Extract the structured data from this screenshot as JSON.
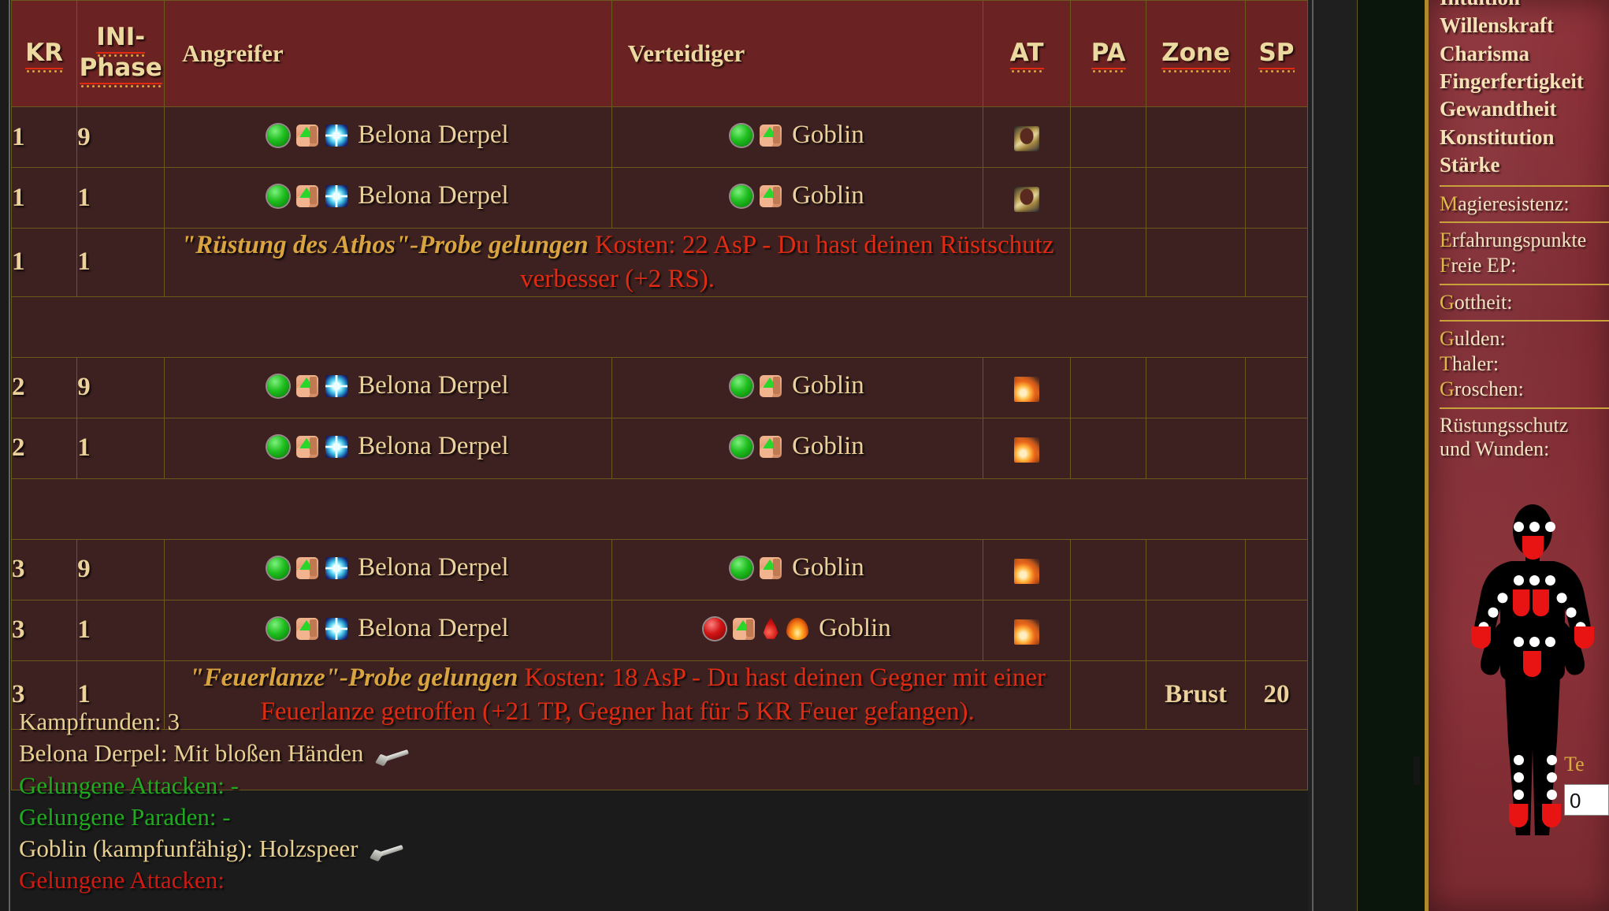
{
  "table": {
    "headers": {
      "kr": "KR",
      "ini_line1": "INI-",
      "ini_line2": "Phase",
      "angreifer": "Angreifer",
      "verteidiger": "Verteidiger",
      "at": "AT",
      "pa": "PA",
      "zone": "Zone",
      "sp": "SP"
    },
    "rows": [
      {
        "type": "combat",
        "kr": "1",
        "ini": "9",
        "attacker": "Belona Derpel",
        "attacker_icons": [
          "green-ball",
          "flex-arm",
          "sparkle"
        ],
        "defender": "Goblin",
        "defender_icons": [
          "green-ball",
          "flex-arm"
        ],
        "at_icon": "spell-armor",
        "pa": "",
        "zone": "",
        "sp": ""
      },
      {
        "type": "combat",
        "kr": "1",
        "ini": "1",
        "attacker": "Belona Derpel",
        "attacker_icons": [
          "green-ball",
          "flex-arm",
          "sparkle"
        ],
        "defender": "Goblin",
        "defender_icons": [
          "green-ball",
          "flex-arm"
        ],
        "at_icon": "spell-armor",
        "pa": "",
        "zone": "",
        "sp": ""
      },
      {
        "type": "message",
        "kr": "1",
        "ini": "1",
        "spell": "\"Rüstung des Athos\"-Probe gelungen",
        "text": "Kosten: 22 AsP - Du hast deinen Rüstschutz verbesser (+2 RS).",
        "pa": "",
        "zone": "",
        "sp": ""
      },
      {
        "type": "separator"
      },
      {
        "type": "combat",
        "kr": "2",
        "ini": "9",
        "attacker": "Belona Derpel",
        "attacker_icons": [
          "green-ball",
          "flex-arm",
          "sparkle"
        ],
        "defender": "Goblin",
        "defender_icons": [
          "green-ball",
          "flex-arm"
        ],
        "at_icon": "spell-fire",
        "pa": "",
        "zone": "",
        "sp": ""
      },
      {
        "type": "combat",
        "kr": "2",
        "ini": "1",
        "attacker": "Belona Derpel",
        "attacker_icons": [
          "green-ball",
          "flex-arm",
          "sparkle"
        ],
        "defender": "Goblin",
        "defender_icons": [
          "green-ball",
          "flex-arm"
        ],
        "at_icon": "spell-fire",
        "pa": "",
        "zone": "",
        "sp": ""
      },
      {
        "type": "separator"
      },
      {
        "type": "combat",
        "kr": "3",
        "ini": "9",
        "attacker": "Belona Derpel",
        "attacker_icons": [
          "green-ball",
          "flex-arm",
          "sparkle"
        ],
        "defender": "Goblin",
        "defender_icons": [
          "green-ball",
          "flex-arm"
        ],
        "at_icon": "spell-fire",
        "pa": "",
        "zone": "",
        "sp": ""
      },
      {
        "type": "combat",
        "kr": "3",
        "ini": "1",
        "attacker": "Belona Derpel",
        "attacker_icons": [
          "green-ball",
          "flex-arm",
          "sparkle"
        ],
        "defender": "Goblin",
        "defender_icons": [
          "red-ball",
          "flex-arm",
          "blood-drop",
          "fire"
        ],
        "at_icon": "spell-fire",
        "pa": "",
        "zone": "",
        "sp": ""
      },
      {
        "type": "message",
        "kr": "3",
        "ini": "1",
        "spell": "\"Feuerlanze\"-Probe gelungen",
        "text": "Kosten: 18 AsP - Du hast deinen Gegner mit einer Feuerlanze getroffen (+21 TP, Gegner hat für 5 KR Feuer gefangen).",
        "pa": "",
        "zone": "Brust",
        "sp": "20"
      },
      {
        "type": "tail"
      }
    ]
  },
  "summary": {
    "lines": [
      {
        "color": "gold",
        "text": "Kampfrunden: 3",
        "bold_tail": "3"
      },
      {
        "color": "gold",
        "text": "Belona Derpel: Mit bloßen Händen",
        "icon": "pistol"
      },
      {
        "color": "green",
        "text": "Gelungene Attacken: -"
      },
      {
        "color": "green",
        "text": "Gelungene Paraden: -"
      },
      {
        "color": "gold",
        "text": "Goblin (kampfunfähig): Holzspeer",
        "icon": "pistol"
      },
      {
        "color": "red",
        "text": "Gelungene Attacken:"
      }
    ]
  },
  "sidebar": {
    "attributes": [
      "Intuition",
      "Willenskraft",
      "Charisma",
      "Fingerfertigkeit",
      "Gewandtheit",
      "Konstitution",
      "Stärke"
    ],
    "stats": [
      {
        "label": "Magieresistenz:"
      },
      {
        "label": "Erfahrungspunkte"
      },
      {
        "label": "Freie EP:"
      },
      {
        "label": "Gottheit:"
      },
      {
        "label": "Gulden:"
      },
      {
        "label": "Thaler:"
      },
      {
        "label": "Groschen:"
      }
    ],
    "wounds_title_line1": "Rüstungsschutz",
    "wounds_title_line2": "und Wunden:",
    "right_label": "Te",
    "right_input_value": "0"
  }
}
